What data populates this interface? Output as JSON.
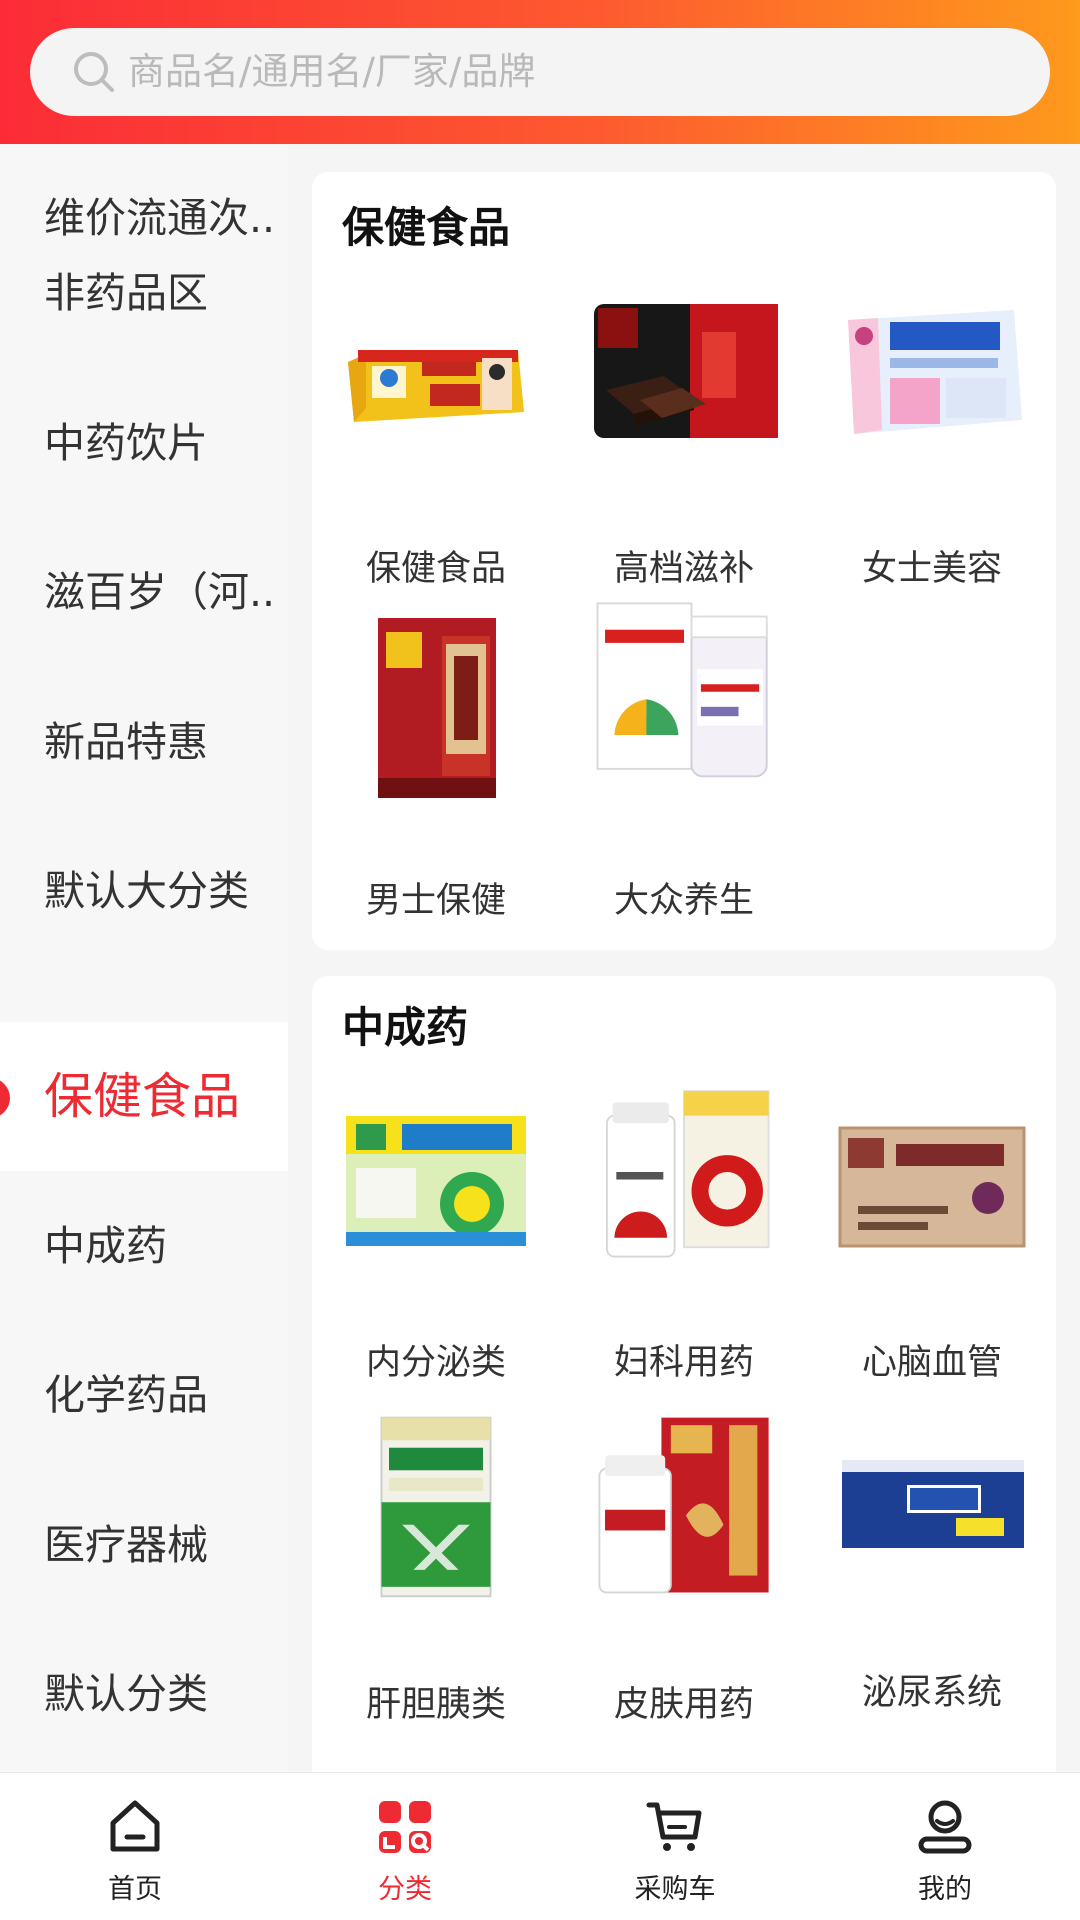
{
  "search": {
    "placeholder": "商品名/通用名/厂家/品牌"
  },
  "sidebar": {
    "items": [
      {
        "label": "维价流通次..."
      },
      {
        "label": "非药品区"
      },
      {
        "label": "中药饮片"
      },
      {
        "label": "滋百岁（河..."
      },
      {
        "label": "新品特惠"
      },
      {
        "label": "默认大分类"
      },
      {
        "label": "保健食品",
        "active": true
      },
      {
        "label": "中成药"
      },
      {
        "label": "化学药品"
      },
      {
        "label": "医疗器械"
      },
      {
        "label": "默认分类"
      }
    ]
  },
  "sections": [
    {
      "title": "保健食品",
      "items": [
        {
          "label": "保健食品",
          "icon": "herbal-tea-box"
        },
        {
          "label": "高档滋补",
          "icon": "ejiao-gift-box"
        },
        {
          "label": "女士美容",
          "icon": "ejiao-oral-liquid-box"
        },
        {
          "label": "男士保健",
          "icon": "haigou-pill-box"
        },
        {
          "label": "大众养生",
          "icon": "multivitamin-bottle"
        }
      ]
    },
    {
      "title": "中成药",
      "items": [
        {
          "label": "内分泌类",
          "icon": "jiangtang-capsule-box"
        },
        {
          "label": "妇科用药",
          "icon": "rupixiao-tablet-bottle"
        },
        {
          "label": "心脑血管",
          "icon": "xuesaitong-tablet-box"
        },
        {
          "label": "肝胆胰类",
          "icon": "xiaoyan-lidan-box"
        },
        {
          "label": "皮肤用药",
          "icon": "yangxue-shengfa-capsule"
        },
        {
          "label": "泌尿系统",
          "icon": "shilin-tablet-box"
        }
      ]
    }
  ],
  "tabbar": {
    "items": [
      {
        "label": "首页",
        "icon": "home-icon"
      },
      {
        "label": "分类",
        "icon": "category-icon",
        "active": true
      },
      {
        "label": "采购车",
        "icon": "cart-icon"
      },
      {
        "label": "我的",
        "icon": "profile-icon"
      }
    ]
  },
  "colors": {
    "accent": "#ee2b33",
    "header_start": "#fb2c37",
    "header_end": "#fe9a1c"
  }
}
